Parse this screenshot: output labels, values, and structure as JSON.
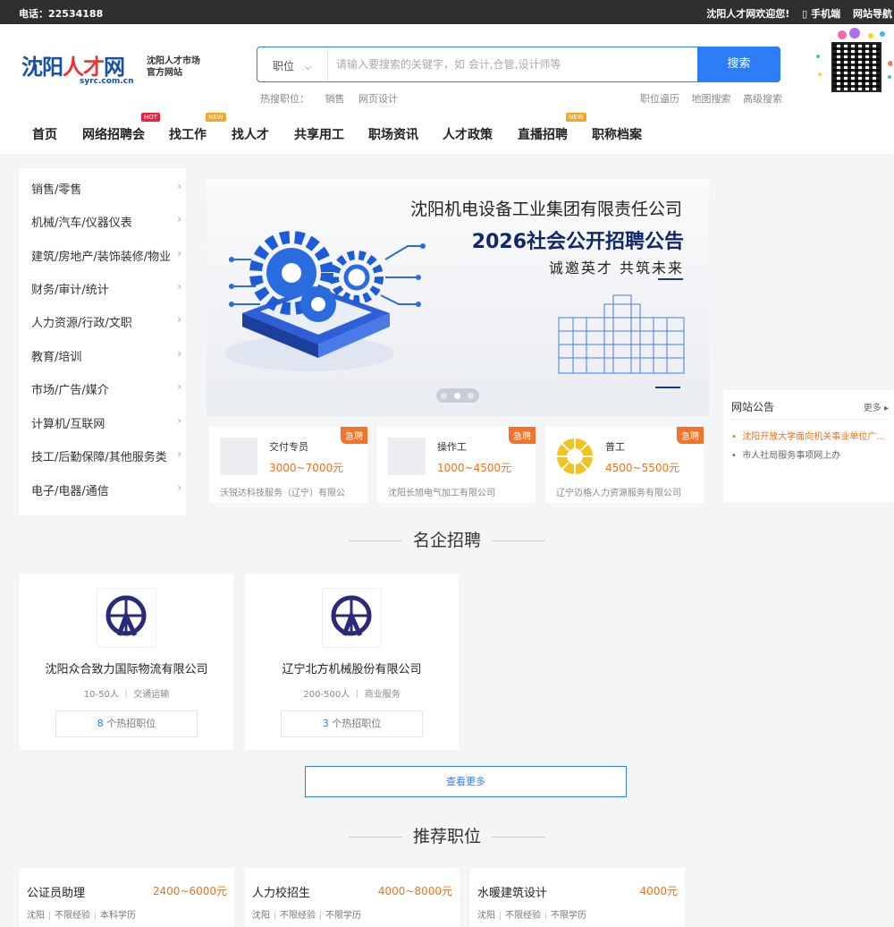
{
  "topbar": {
    "phone": "电话：22534188",
    "welcome": "沈阳人才网欢迎您!",
    "mobile": "手机端",
    "site_nav": "网站导航"
  },
  "logo": {
    "name_blue1": "沈阳",
    "name_red": "人才",
    "name_blue2": "网",
    "domain": "syrc.com.cn",
    "slogan_line1": "沈阳人才市场",
    "slogan_line2": "官方网站"
  },
  "search": {
    "type": "职位",
    "placeholder": "请输入要搜索的关键字，如 会计,仓管,设计师等",
    "button": "搜索",
    "hot_label": "热搜职位：",
    "hot_items": [
      "销售",
      "网页设计"
    ],
    "links": [
      "职位逼历",
      "地图搜索",
      "高级搜索"
    ]
  },
  "nav": {
    "items": [
      "首页",
      "网络招聘会",
      "找工作",
      "找人才",
      "共享用工",
      "职场资讯",
      "人才政策",
      "直播招聘",
      "职称档案"
    ],
    "badge_hot": "HOT",
    "badge_new": "NEW"
  },
  "categories": [
    "销售/零售",
    "机械/汽车/仪器仪表",
    "建筑/房地产/装饰装修/物业",
    "财务/审计/统计",
    "人力资源/行政/文职",
    "教育/培训",
    "市场/广告/媒介",
    "计算机/互联网",
    "技工/后勤保障/其他服务类",
    "电子/电器/通信"
  ],
  "banner": {
    "title1": "沈阳机电设备工业集团有限责任公司",
    "title2": "2026社会公开招聘公告",
    "title3": "诚邀英才  共筑未来",
    "dots": 3,
    "active_dot": 2
  },
  "urgent_jobs": [
    {
      "title": "交付专员",
      "salary": "3000~7000元",
      "company": "沃锐达科技服务（辽宁）有限公",
      "tag": "急聘"
    },
    {
      "title": "操作工",
      "salary": "1000~4500元",
      "company": "沈阳长旭电气加工有限公司",
      "tag": "急聘"
    },
    {
      "title": "普工",
      "salary": "4500~5500元",
      "company": "辽宁迈格人力资源服务有限公司",
      "tag": "急聘"
    }
  ],
  "notice": {
    "title": "网站公告",
    "more": "更多",
    "items": [
      "沈阳开放大学面向机关事业单位广...",
      "市人社局服务事项网上办"
    ]
  },
  "famous": {
    "title": "名企招聘",
    "companies": [
      {
        "name": "沈阳众合致力国际物流有限公司",
        "size": "10-50人",
        "industry": "交通运输",
        "jobs_count": "8",
        "jobs_text": "个热招职位"
      },
      {
        "name": "辽宁北方机械股份有限公司",
        "size": "200-500人",
        "industry": "商业服务",
        "jobs_count": "3",
        "jobs_text": "个热招职位"
      }
    ],
    "more_button": "查看更多"
  },
  "recommend": {
    "title": "推荐职位",
    "jobs": [
      {
        "title": "公证员助理",
        "salary": "2400~6000元",
        "city": "沈阳",
        "exp": "不限经验",
        "edu": "本科学历"
      },
      {
        "title": "人力校招生",
        "salary": "4000~8000元",
        "city": "沈阳",
        "exp": "不限经验",
        "edu": "不限学历"
      },
      {
        "title": "水暖建筑设计",
        "salary": "4000元",
        "city": "沈阳",
        "exp": "不限经验",
        "edu": "不限学历"
      }
    ]
  },
  "colors": {
    "accent": "#2f7df6",
    "salary": "#f2711c",
    "topbar": "#2e2f31",
    "urgent": "#f57229"
  }
}
